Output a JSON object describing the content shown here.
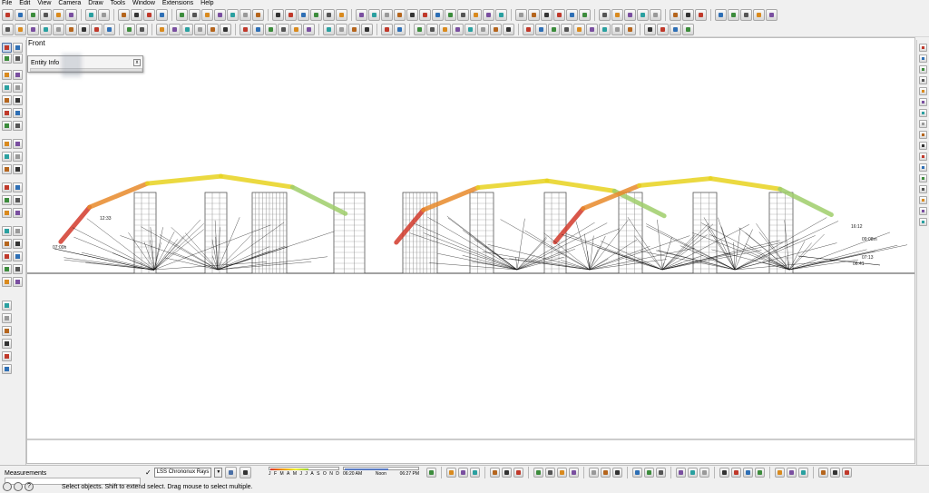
{
  "menu": [
    "File",
    "Edit",
    "View",
    "Camera",
    "Draw",
    "Tools",
    "Window",
    "Extensions",
    "Help"
  ],
  "viewport": {
    "view_label": "Front"
  },
  "entity_info": {
    "title": "Entity Info",
    "close_label": "x"
  },
  "status": {
    "measurements_label": "Measurements",
    "status_text": "Select objects. Shift to extend select. Drag mouse to select multiple.",
    "help_icon": "?"
  },
  "chrono": {
    "check": "✓",
    "selected": "LSS Chrononux Rays",
    "dd": "▼",
    "months": [
      "J",
      "F",
      "M",
      "A",
      "M",
      "J",
      "J",
      "A",
      "S",
      "O",
      "N",
      "D"
    ],
    "month_fill": 0.55,
    "time_labels": [
      "06:20 AM",
      "Noon",
      "06:27 PM"
    ],
    "time_fill": 0.58
  },
  "colors": {
    "arc_red": "#d23a2c",
    "arc_orange": "#e88a2a",
    "arc_yellow": "#e8d21e",
    "arc_green": "#9fce6a",
    "ray": "#000000",
    "building": "#555555"
  },
  "scene": {
    "arc_labels": [
      "07:00h",
      "16:12",
      "07:13",
      "06:41",
      "12:33",
      "09:08m"
    ]
  }
}
